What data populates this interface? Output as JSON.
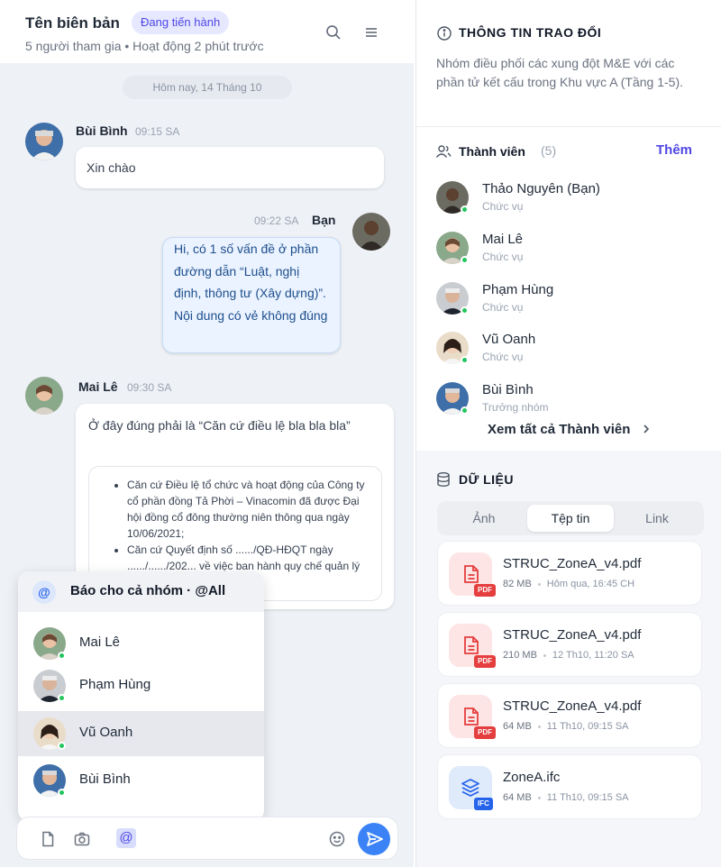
{
  "chat": {
    "title": "Tên biên bản",
    "status": "Đang tiến hành",
    "subtitle": "5 người tham gia • Hoạt động 2 phút trước",
    "date_divider": "Hôm nay, 14 Tháng 10",
    "messages": [
      {
        "sender": "Bùi Bình",
        "time": "09:15 SA",
        "text": "Xin chào"
      },
      {
        "sender": "Bạn",
        "time": "09:22 SA",
        "text": "Hi, có 1 số vấn đề ở phần đường dẫn “Luật, nghị định, thông tư (Xây dựng)”. Nội dung có vẻ không đúng"
      },
      {
        "sender": "Mai Lê",
        "time": "09:30 SA",
        "text": "Ở đây đúng phải là “Căn cứ điều lệ bla bla bla”",
        "quote_items": [
          "Căn cứ Điều lệ tổ chức và hoạt động của Công ty cổ phần đồng Tả Phời – Vinacomin đã được Đại hội đồng cổ đông thường niên thông qua ngày 10/06/2021;",
          "Căn cứ Quyết định số ....../QĐ-HĐQT ngày ....../....../202... về việc ban hành quy chế quản lý đầu tư xây dựng trong"
        ]
      }
    ],
    "mention_popup": {
      "all_label": "Báo cho cả nhóm · @All",
      "items": [
        "Mai Lê",
        "Phạm Hùng",
        "Vũ Oanh",
        "Bùi Bình"
      ],
      "highlighted": "Vũ Oanh"
    },
    "composer": {
      "at_symbol": "@"
    }
  },
  "side": {
    "info_title": "THÔNG TIN TRAO ĐỔI",
    "info_desc": "Nhóm điều phối các xung đột M&E với các phần tử kết cấu trong Khu vực A (Tầng 1-5).",
    "members_title": "Thành viên",
    "members_count": "(5)",
    "add_label": "Thêm",
    "members": [
      {
        "name": "Thảo Nguyên (Bạn)",
        "role": "Chức vụ"
      },
      {
        "name": "Mai Lê",
        "role": "Chức vụ"
      },
      {
        "name": "Phạm Hùng",
        "role": "Chức vụ"
      },
      {
        "name": "Vũ Oanh",
        "role": "Chức vụ"
      },
      {
        "name": "Bùi Bình",
        "role": "Trưởng nhóm"
      }
    ],
    "see_all_label": "Xem tất cả Thành viên",
    "data_title": "DỮ LIỆU",
    "tabs": [
      "Ảnh",
      "Tệp tin",
      "Link"
    ],
    "active_tab": "Tệp tin",
    "files": [
      {
        "name": "STRUC_ZoneA_v4.pdf",
        "size": "82 MB",
        "date": "Hôm qua, 16:45 CH",
        "type": "PDF"
      },
      {
        "name": "STRUC_ZoneA_v4.pdf",
        "size": "210 MB",
        "date": "12 Th10, 11:20 SA",
        "type": "PDF"
      },
      {
        "name": "STRUC_ZoneA_v4.pdf",
        "size": "64 MB",
        "date": "11 Th10, 09:15 SA",
        "type": "PDF"
      },
      {
        "name": "ZoneA.ifc",
        "size": "64 MB",
        "date": "11 Th10, 09:15 SA",
        "type": "IFC"
      }
    ]
  },
  "colors": {
    "accent": "#4f46e5",
    "send": "#3b82f6",
    "online": "#22c55e",
    "pdf": "#e53e3e",
    "ifc": "#2563eb"
  }
}
